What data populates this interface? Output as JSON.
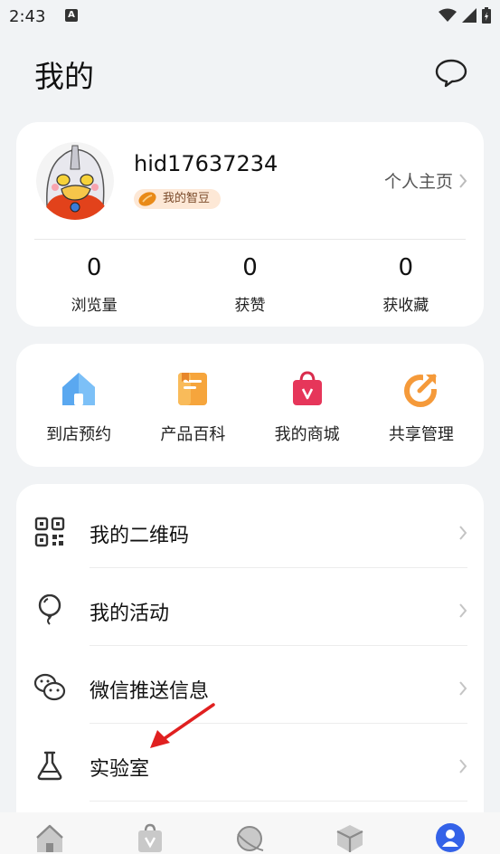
{
  "status_bar": {
    "time": "2:43",
    "notif_letter": "A"
  },
  "header": {
    "title": "我的"
  },
  "profile": {
    "username": "hid17637234",
    "bean_label": "我的智豆",
    "homepage_label": "个人主页",
    "stats": [
      {
        "value": "0",
        "label": "浏览量"
      },
      {
        "value": "0",
        "label": "获赞"
      },
      {
        "value": "0",
        "label": "获收藏"
      }
    ]
  },
  "shortcuts": [
    {
      "label": "到店预约",
      "icon": "store-icon"
    },
    {
      "label": "产品百科",
      "icon": "book-icon"
    },
    {
      "label": "我的商城",
      "icon": "shopping-bag-icon"
    },
    {
      "label": "共享管理",
      "icon": "share-icon"
    }
  ],
  "menu": [
    {
      "label": "我的二维码",
      "icon": "qrcode-icon"
    },
    {
      "label": "我的活动",
      "icon": "balloon-icon"
    },
    {
      "label": "微信推送信息",
      "icon": "wechat-icon"
    },
    {
      "label": "实验室",
      "icon": "flask-icon"
    }
  ],
  "bottom_nav": [
    {
      "icon": "home-icon"
    },
    {
      "icon": "shop-bag-icon"
    },
    {
      "icon": "planet-icon"
    },
    {
      "icon": "cube-icon"
    },
    {
      "icon": "profile-icon",
      "active": true
    }
  ],
  "colors": {
    "accent": "#3462e8",
    "background": "#f1f3f5",
    "card": "#ffffff"
  }
}
